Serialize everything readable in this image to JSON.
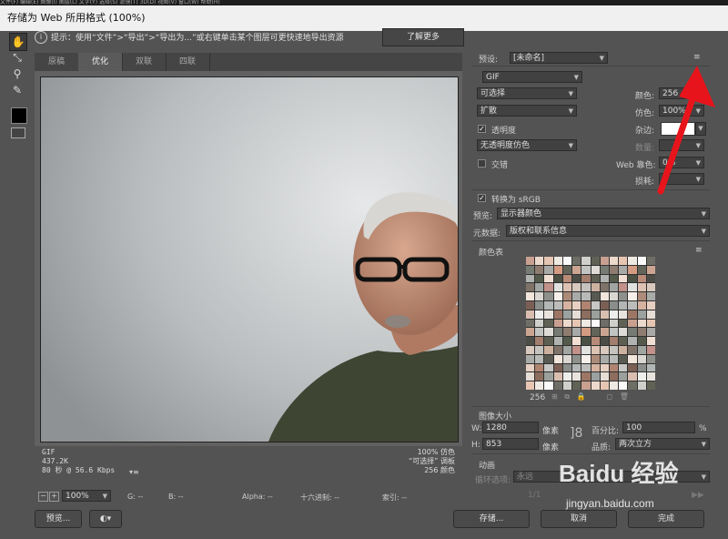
{
  "window": {
    "title": "存储为 Web 所用格式 (100%)",
    "menu_strip": "文件(F)  编辑(E)  图像(I)  图层(L)  文字(Y)  选择(S)  滤镜(T)  3D(D)  视图(V)  窗口(W)  帮助(H)"
  },
  "hint": {
    "text": "提示：使用“文件”>“导出”>“导出为...”或右键单击某个图层可更快速地导出资源",
    "learn_more": "了解更多"
  },
  "tabs": [
    "原稿",
    "优化",
    "双联",
    "四联"
  ],
  "image_info": {
    "format": "GIF",
    "size": "437.2K",
    "time": "80 秒 @ 56.6 Kbps",
    "quality": "100% 仿色",
    "palette": "“可选择” 调板",
    "colors_count": "256 颜色"
  },
  "statusbar": {
    "zoom": "100%",
    "g": "G: --",
    "b": "B: --",
    "alpha": "Alpha: --",
    "hex": "十六进制: --",
    "index": "索引: --"
  },
  "buttons": {
    "preview": "预览...",
    "save": "存储...",
    "cancel": "取消",
    "done": "完成"
  },
  "settings": {
    "preset_label": "预设:",
    "preset_value": "[未命名]",
    "format": "GIF",
    "reduction": "可选择",
    "dither_algo": "扩散",
    "colors_label": "颜色:",
    "colors_value": "256",
    "dither_label": "仿色:",
    "dither_value": "100%",
    "transparency": "透明度",
    "matte_label": "杂边:",
    "trans_dither": "无透明度仿色",
    "amount_label": "数量:",
    "interlaced": "交错",
    "web_snap_label": "Web 靠色:",
    "web_snap_value": "0%",
    "lossy_label": "损耗:",
    "lossy_value": "0",
    "convert_srgb": "转换为 sRGB",
    "preview_label": "预览:",
    "preview_value": "显示器颜色",
    "metadata_label": "元数据:",
    "metadata_value": "版权和联系信息"
  },
  "color_table": {
    "title": "颜色表",
    "count": "256"
  },
  "image_size": {
    "title": "图像大小",
    "w_label": "W:",
    "w_value": "1280",
    "h_label": "H:",
    "h_value": "853",
    "unit": "像素",
    "percent_label": "百分比:",
    "percent_value": "100",
    "percent_unit": "%",
    "quality_label": "品质:",
    "quality_value": "两次立方"
  },
  "animation": {
    "title": "动画",
    "loop_label": "循环选项:",
    "loop_value": "永远",
    "frame": "1/1"
  },
  "watermark": {
    "brand": "Baidu 经验",
    "url": "jingyan.baidu.com"
  },
  "colors": {
    "accent_arrow": "#e8141c",
    "panel": "#535353"
  },
  "palette": [
    "#c9a090",
    "#7b5f55",
    "#d8c8bd",
    "#a9aaa8",
    "#e9e3de",
    "#585a52",
    "#b88b78",
    "#ecd9cc",
    "#8a8f8c",
    "#c6c3be",
    "#d49a82",
    "#9e7665",
    "#f1e5dc",
    "#4c4d46",
    "#e6c6b2",
    "#b2b7b5",
    "#cdb19f",
    "#626459",
    "#9ba19f",
    "#dad6d1",
    "#a37e6c",
    "#efe9e3",
    "#bcbdba",
    "#7e7269",
    "#cca592",
    "#e5ddd6",
    "#8e918b",
    "#5c5f52",
    "#fafafa",
    "#d6b3a0",
    "#a0a5a2",
    "#c2c4c2",
    "#8d6d5e",
    "#f7efe9",
    "#b1b3b0",
    "#6e6e66",
    "#e7d0c2",
    "#c1918a",
    "#dfdbd7",
    "#9ba09c",
    "#ad8b7a",
    "#535a4b",
    "#cfd0cc",
    "#b08471",
    "#e1e1e0",
    "#757a73",
    "#d9beb0",
    "#a8aba8",
    "#f2dfd3",
    "#606255",
    "#c7c7c5",
    "#ddc2b3",
    "#8f7c70",
    "#eeeeec",
    "#b8bab7",
    "#4a5043"
  ]
}
